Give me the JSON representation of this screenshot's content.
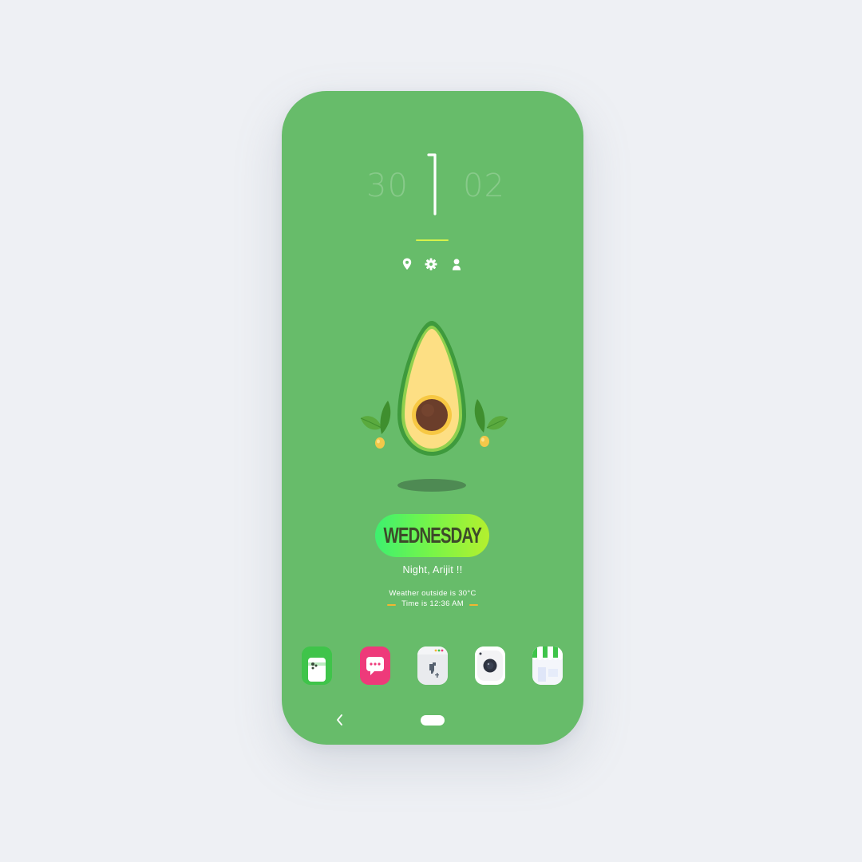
{
  "clock": {
    "left": "30",
    "center": "1",
    "right": "02"
  },
  "quick_icons": [
    "location-pin-icon",
    "gear-icon",
    "user-icon"
  ],
  "day_label": "WEDNESDAY",
  "greeting": "Night, Arijit !!",
  "weather_line": "Weather outside is 30°C",
  "time_line": "Time is 12:36 AM",
  "dock_apps": [
    {
      "name": "phone-app-icon"
    },
    {
      "name": "messages-app-icon"
    },
    {
      "name": "browser-app-icon"
    },
    {
      "name": "camera-app-icon"
    },
    {
      "name": "store-app-icon"
    }
  ],
  "colors": {
    "background": "#67bc6a",
    "accent_line": "#d6f24a",
    "dash": "#f2b631",
    "pill_start": "#3ef06f",
    "pill_end": "#b4f02e",
    "day_text": "#3d4a2a"
  }
}
